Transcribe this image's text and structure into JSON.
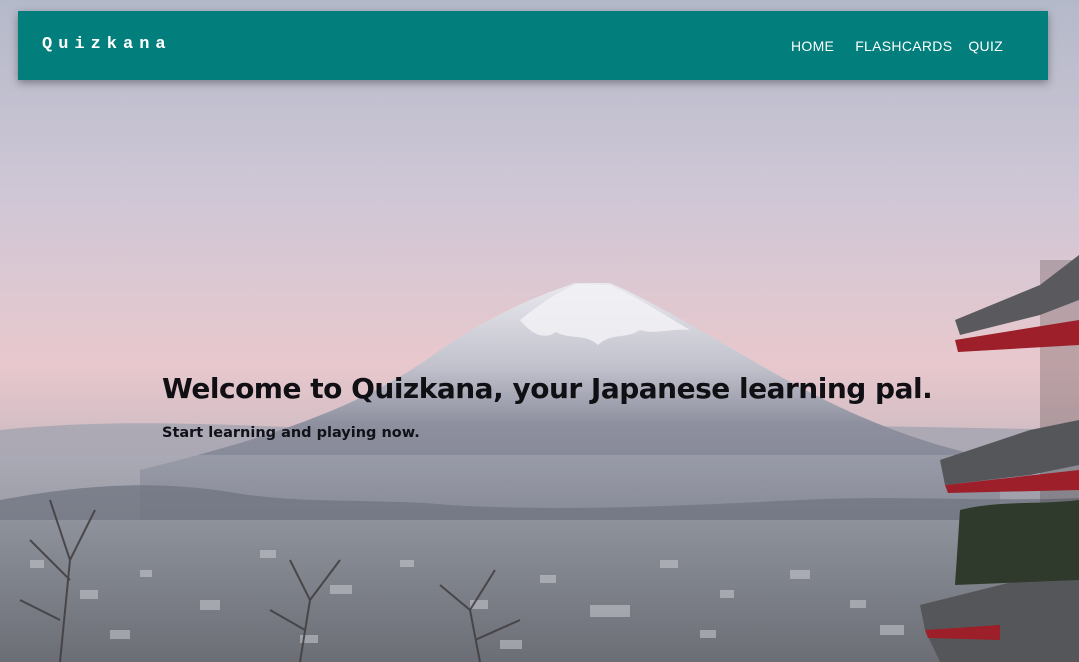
{
  "brand": {
    "name": "Quizkana"
  },
  "nav": {
    "items": [
      {
        "label": "HOME"
      },
      {
        "label": "FLASHCARDS"
      },
      {
        "label": "QUIZ"
      }
    ]
  },
  "hero": {
    "title": "Welcome to Quizkana, your Japanese learning pal.",
    "subtitle": "Start learning and playing now.",
    "background_image": "mount-fuji-with-pagoda-and-city"
  },
  "colors": {
    "navbar": "#027f7d",
    "nav_text": "#ffffff",
    "hero_text": "#0f0f14"
  }
}
